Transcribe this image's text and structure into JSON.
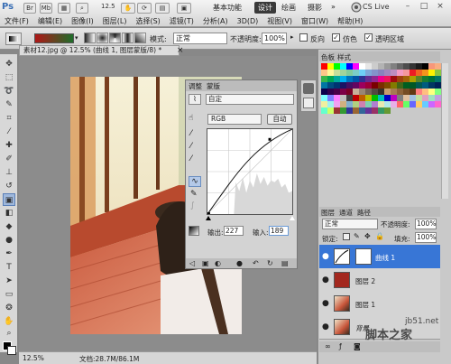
{
  "app": {
    "logo": "Ps",
    "zoom": "12.5",
    "workspaces": [
      "基本功能",
      "设计",
      "绘画",
      "摄影",
      "»"
    ],
    "cs_live": "CS Live",
    "window_buttons": [
      "–",
      "□",
      "×"
    ]
  },
  "menu": [
    "文件(F)",
    "编辑(E)",
    "图像(I)",
    "图层(L)",
    "选择(S)",
    "滤镜(T)",
    "分析(A)",
    "3D(D)",
    "视图(V)",
    "窗口(W)",
    "帮助(H)"
  ],
  "options": {
    "mode_label": "模式:",
    "mode_value": "正常",
    "opacity_label": "不透明度:",
    "opacity_value": "100%",
    "reverse_label": "反向",
    "dither_label": "仿色",
    "transparency_label": "透明区域",
    "reverse_checked": false,
    "dither_checked": true,
    "transparency_checked": true
  },
  "document": {
    "tab_title": "素材12.jpg @ 12.5% (曲线 1, 图层蒙版/8) *",
    "close": "×"
  },
  "status": {
    "zoom": "12.5%",
    "doc_size": "文档:28.7M/86.1M"
  },
  "adjustments": {
    "tabs": [
      "调整",
      "蒙版"
    ],
    "preset": "自定",
    "channel": "RGB",
    "auto_label": "自动",
    "output_label": "输出:",
    "output_value": "227",
    "input_label": "输入:",
    "input_value": "189"
  },
  "swatches_panel": {
    "tabs": [
      "色板",
      "样式"
    ],
    "colors": [
      "#ff0000",
      "#ffff00",
      "#00ff00",
      "#00ffff",
      "#0000ff",
      "#ff00ff",
      "#ffffff",
      "#e6e6e6",
      "#cccccc",
      "#b3b3b3",
      "#999999",
      "#808080",
      "#666666",
      "#4d4d4d",
      "#333333",
      "#1a1a1a",
      "#000000",
      "#f7977a",
      "#f9ad81",
      "#fdc68a",
      "#fff79a",
      "#c4df9b",
      "#a2d39c",
      "#82ca9d",
      "#7bcdc8",
      "#6ecff6",
      "#7ea7d8",
      "#8493ca",
      "#8882be",
      "#a187be",
      "#bc8dbf",
      "#f49ac2",
      "#f6989d",
      "#ed1c24",
      "#f26522",
      "#f7941d",
      "#fff200",
      "#8dc63f",
      "#39b54a",
      "#00a651",
      "#00a99d",
      "#00aeef",
      "#0072bc",
      "#0054a6",
      "#2e3192",
      "#662d91",
      "#92278f",
      "#ec008c",
      "#ed145b",
      "#9e0b0f",
      "#a0410d",
      "#a36209",
      "#aba000",
      "#598527",
      "#1a7b30",
      "#007236",
      "#00746b",
      "#0076a3",
      "#004a80",
      "#003471",
      "#1b1464",
      "#440e62",
      "#630460",
      "#9e005d",
      "#9e0039",
      "#790000",
      "#7b2e00",
      "#7d4900",
      "#827b00",
      "#406618",
      "#005e20",
      "#005826",
      "#005952",
      "#005b7f",
      "#003663",
      "#002157",
      "#0d004c",
      "#32004b",
      "#4b0049",
      "#7b0046",
      "#7a0026",
      "#c7b299",
      "#998675",
      "#736357",
      "#534741",
      "#37302a",
      "#c69c6d",
      "#a67c52",
      "#8c6239",
      "#754c24",
      "#603913",
      "#ff8080",
      "#ffbf80",
      "#ffff80",
      "#80ff80",
      "#80ffff",
      "#8080ff",
      "#ff80ff",
      "#c0c0c0",
      "#404040",
      "#bf0000",
      "#bf5f00",
      "#bfbf00",
      "#00bf00",
      "#00bfbf",
      "#0000bf",
      "#bf00bf",
      "#7f7f7f",
      "#e0c0a0",
      "#a0c0e0",
      "#c0e0a0",
      "#e0a0c0",
      "#a0e0c0",
      "#c0a0e0",
      "#f0f0a0",
      "#a0f0f0",
      "#f0a0f0",
      "#d0b080",
      "#80b0d0",
      "#b0d080",
      "#d080b0",
      "#80d0b0",
      "#b080d0",
      "#e8e8b0",
      "#b0e8e8",
      "#e8b0e8",
      "#ff6666",
      "#66ff66",
      "#6666ff",
      "#ffcc66",
      "#66ccff",
      "#cc66ff",
      "#ff66cc",
      "#66ffcc",
      "#ccff66",
      "#993333",
      "#339933",
      "#333399",
      "#996633",
      "#336699",
      "#663399",
      "#993366",
      "#339966",
      "#669933"
    ]
  },
  "layers_panel": {
    "tabs": [
      "图层",
      "通道",
      "路径"
    ],
    "blend_mode": "正常",
    "opacity_label": "不透明度:",
    "opacity_value": "100%",
    "lock_label": "锁定:",
    "fill_label": "填充:",
    "fill_value": "100%",
    "layers": [
      {
        "name": "曲线 1",
        "selected": true,
        "type": "adjustment"
      },
      {
        "name": "图层 2",
        "selected": false,
        "type": "red"
      },
      {
        "name": "图层 1",
        "selected": false,
        "type": "photo"
      },
      {
        "name": "背景",
        "selected": false,
        "type": "photo"
      }
    ]
  },
  "watermark": {
    "text": "脚本之家",
    "url": "jb51.net"
  }
}
